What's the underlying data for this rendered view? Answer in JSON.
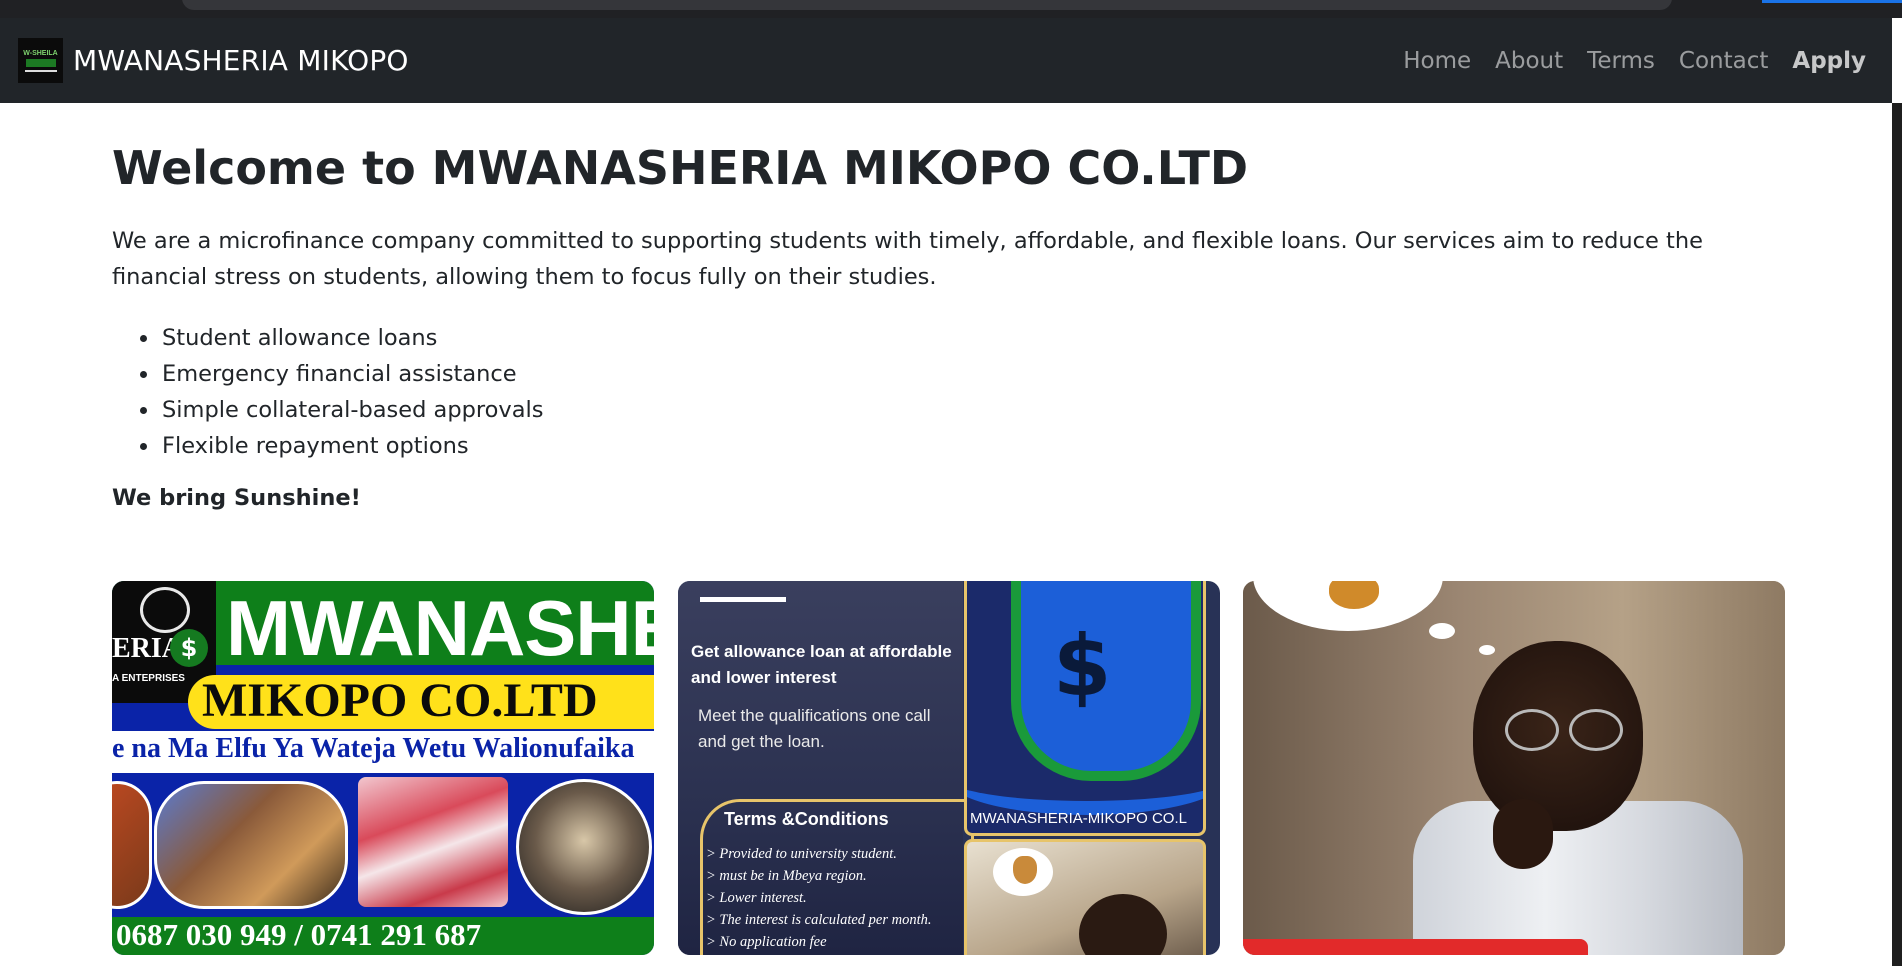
{
  "navbar": {
    "logo_text": "W-SHEILA",
    "brand": "MWANASHERIA MIKOPO",
    "links": [
      {
        "label": "Home"
      },
      {
        "label": "About"
      },
      {
        "label": "Terms"
      },
      {
        "label": "Contact"
      },
      {
        "label": "Apply",
        "active": true
      }
    ]
  },
  "main": {
    "title": "Welcome to MWANASHERIA MIKOPO CO.LTD",
    "intro": "We are a microfinance company committed to supporting students with timely, affordable, and flexible loans. Our services aim to reduce the financial stress on students, allowing them to focus fully on their studies.",
    "features": [
      "Student allowance loans",
      "Emergency financial assistance",
      "Simple collateral-based approvals",
      "Flexible repayment options"
    ],
    "tagline": "We bring Sunshine!"
  },
  "cards": {
    "poster1": {
      "logo_era": "ERIA",
      "logo_dollar": "$",
      "logo_enterprises": "A ENTEPRISES",
      "brand": "MWANASHER",
      "company": "MIKOPO CO.LTD",
      "slogan": "e na Ma Elfu Ya Wateja Wetu Walionufaika",
      "phones": "0687 030 949 / 0741 291 687"
    },
    "poster2": {
      "headline": "Get allowance loan at affordable and lower interest",
      "subtext": "Meet the qualifications one call and get the loan.",
      "terms_title": "Terms &Conditions",
      "terms": [
        "> Provided to university student.",
        "> must be in Mbeya region.",
        "> Lower  interest.",
        "> The interest is calculated per month.",
        "> No application fee"
      ],
      "shield_symbol": "$",
      "brand": "MWANASHERIA-MIKOPO CO.L"
    }
  },
  "colors": {
    "navbar_bg": "#212529",
    "poster_green": "#0e7f1a",
    "poster_blue": "#0a23a8",
    "poster_yellow": "#ffe11a",
    "terms_gold": "#e7c46a"
  }
}
